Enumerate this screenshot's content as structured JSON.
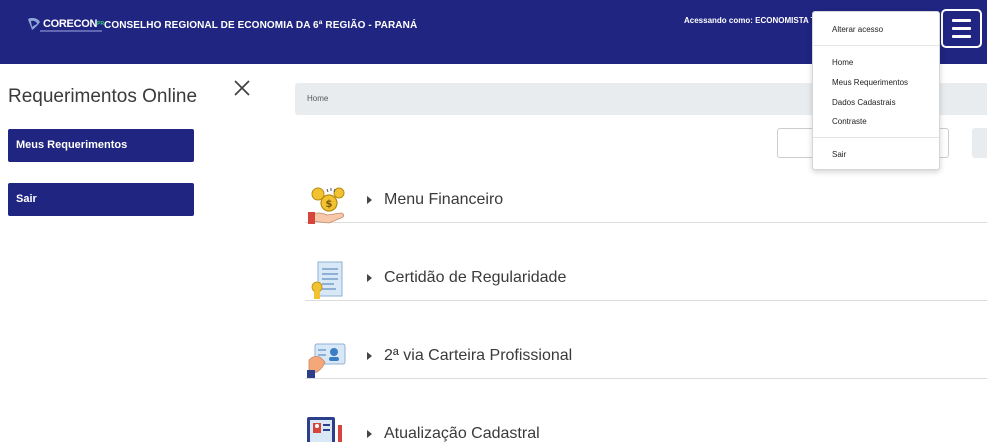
{
  "header": {
    "logo_text": "CORECON",
    "logo_region": "PR",
    "org_title": "CONSELHO REGIONAL DE ECONOMIA DA 6ª REGIÃO - PARANÁ",
    "access_label": "Acessando como: ECONOMISTA T"
  },
  "dropdown": {
    "switch_access": "Alterar acesso",
    "items": [
      "Home",
      "Meus Requerimentos",
      "Dados Cadastrais",
      "Contraste"
    ],
    "logout": "Sair"
  },
  "sidebar": {
    "title": "Requerimentos Online",
    "buttons": [
      "Meus Requerimentos",
      "Sair"
    ]
  },
  "breadcrumb": {
    "home": "Home"
  },
  "menu": [
    {
      "label": "Menu Financeiro",
      "icon": "money-icon"
    },
    {
      "label": "Certidão de Regularidade",
      "icon": "certificate-icon"
    },
    {
      "label": "2ª via Carteira Profissional",
      "icon": "id-card-icon"
    },
    {
      "label": "Atualização Cadastral",
      "icon": "profile-update-icon"
    }
  ],
  "colors": {
    "brand": "#1f2580",
    "accent_green": "#2ecc71",
    "breadcrumb_bg": "#e9ecef"
  }
}
